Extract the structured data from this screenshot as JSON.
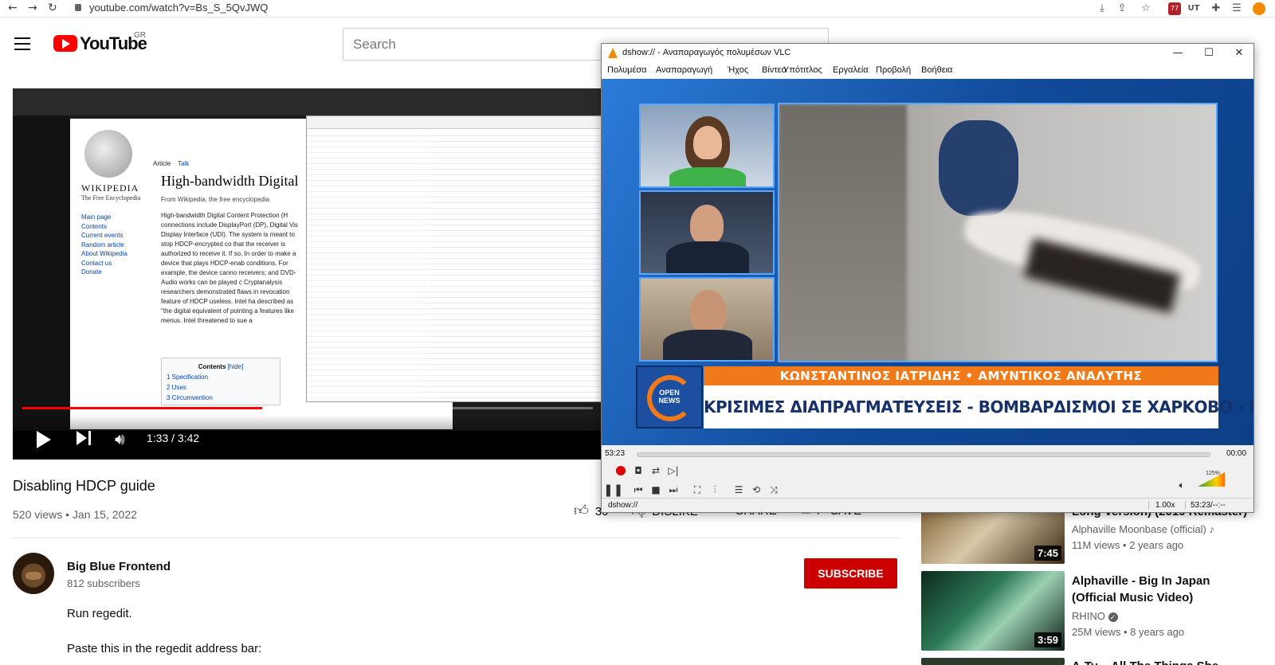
{
  "browser": {
    "url": "youtube.com/watch?v=Bs_S_5QvJWQ",
    "extensions_badge": "77",
    "extension_ut": "UT"
  },
  "header": {
    "logo_text": "YouTube",
    "country": "GR",
    "search_placeholder": "Search"
  },
  "player": {
    "time": "1:33 / 3:42",
    "progress": 0.42,
    "embedded": {
      "wiki_name": "WIKIPEDIA",
      "wiki_sub": "The Free Encyclopedia",
      "nav": [
        "Main page",
        "Contents",
        "Current events",
        "Random article",
        "About Wikipedia",
        "Contact us",
        "Donate"
      ],
      "tab_article": "Article",
      "tab_talk": "Talk",
      "article_title": "High-bandwidth Digital",
      "from": "From Wikipedia, the free encyclopedia",
      "body": "High-bandwidth Digital Content Protection (H connections include DisplayPort (DP), Digital Vis Display Interface (UDI). The system is meant to stop HDCP-encrypted co that the receiver is authorized to receive it. If so, In order to make a device that plays HDCP-enab conditions. For example, the device canno receivers; and DVD-Audio works can be played c Cryptanalysis researchers demonstrated flaws in revocation feature of HDCP useless. Intel ha described as \"the digital equivalent of pointing a features like menus. Intel threatened to sue a",
      "contents_title": "Contents",
      "contents_hide": "[hide]",
      "contents_items": [
        "1 Specification",
        "2 Uses",
        "3 Circumvention"
      ]
    }
  },
  "video": {
    "title": "Disabling HDCP guide",
    "info": "520 views • Jan 15, 2022",
    "like_count": "30",
    "dislike_label": "DISLIKE",
    "share_label": "SHARE",
    "save_label": "SAVE",
    "more_label": "..."
  },
  "channel": {
    "name": "Big Blue Frontend",
    "subs": "812 subscribers",
    "subscribe_label": "SUBSCRIBE"
  },
  "description": {
    "line1": "Run regedit.",
    "line2": "Paste this in the regedit address bar:"
  },
  "recommendations": [
    {
      "title": "Long Version) (2019 Remaster)",
      "channel": "Alphaville Moonbase (official)",
      "meta": "11M views • 2 years ago",
      "duration": "7:45"
    },
    {
      "title": "Alphaville - Big In Japan (Official Music Video)",
      "channel": "RHINO",
      "meta": "25M views • 8 years ago",
      "duration": "3:59"
    },
    {
      "title": "A-Tu... All The Things She",
      "channel": "",
      "meta": "",
      "duration": ""
    }
  ],
  "vlc": {
    "title": "dshow:// - Αναπαραγωγός πολυμέσων VLC",
    "menu": [
      "Πολυμέσα",
      "Αναπαραγωγή",
      "Ήχος",
      "Βίντεο",
      "Υπότιτλος",
      "Εργαλεία",
      "Προβολή",
      "Βοήθεια"
    ],
    "elapsed": "53:23",
    "remaining": "00:00",
    "status_source": "dshow://",
    "speed": "1.00x",
    "status_time": "53:23/--:--",
    "volume": "125%",
    "overlay": {
      "logo_line1": "OPEN",
      "logo_line2": "NEWS",
      "name_line": "ΚΩΝΣΤΑΝΤΙΝΟΣ ΙΑΤΡΙΔΗΣ • ΑΜΥΝΤΙΚΟΣ ΑΝΑΛΥΤΗΣ",
      "headline": "ΚΡΙΣΙΜΕΣ ΔΙΑΠΡΑΓΜΑΤΕΥΣΕΙΣ - ΒΟΜΒΑΡΔΙΣΜΟΙ ΣΕ ΧΑΡΚΟΒΟ - ΝΤΟΝΕΤΣΚ"
    }
  },
  "colors": {
    "yt_red": "#ff0000",
    "subscribe": "#cc0000",
    "banner_orange": "#f07a1a",
    "banner_navy": "#16306a",
    "vlc_orange": "#f08a00"
  }
}
